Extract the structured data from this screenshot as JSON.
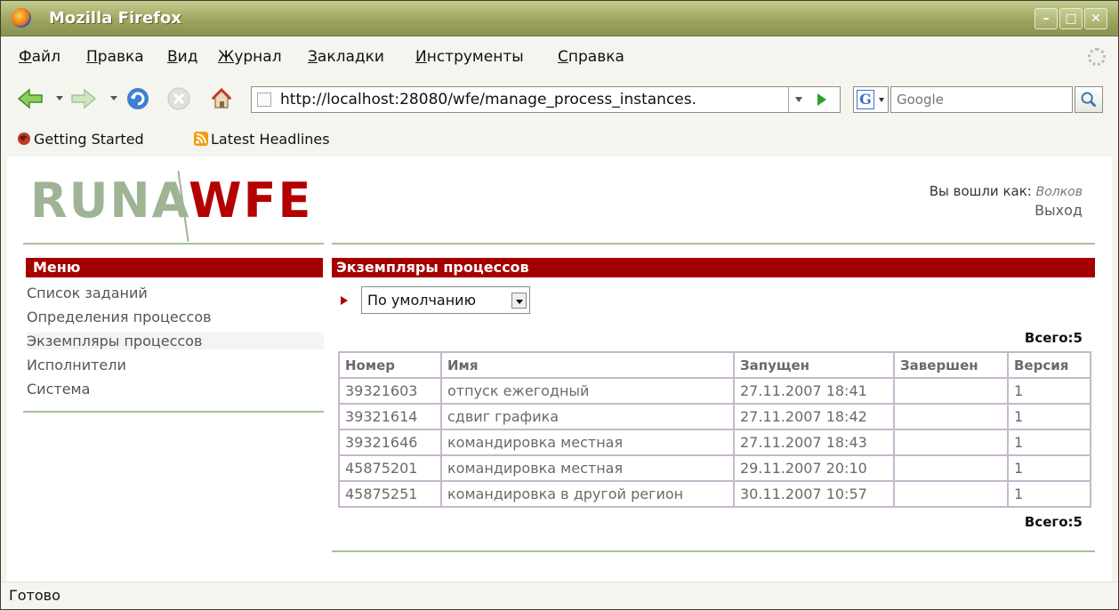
{
  "window": {
    "title": "Mozilla Firefox"
  },
  "menubar": {
    "items": [
      {
        "label": "Файл",
        "hot": "Ф",
        "rest": "айл"
      },
      {
        "label": "Правка",
        "hot": "П",
        "rest": "равка"
      },
      {
        "label": "Вид",
        "hot": "В",
        "rest": "ид"
      },
      {
        "label": "Журнал",
        "hot": "Ж",
        "rest": "урнал"
      },
      {
        "label": "Закладки",
        "hot": "З",
        "rest": "акладки"
      },
      {
        "label": "Инструменты",
        "hot": "И",
        "rest": "нструменты"
      },
      {
        "label": "Справка",
        "hot": "С",
        "rest": "правка"
      }
    ]
  },
  "navbar": {
    "url": "http://localhost:28080/wfe/manage_process_instances.",
    "search_placeholder": "Google"
  },
  "bookmarks": {
    "items": [
      "Getting Started",
      "Latest Headlines"
    ]
  },
  "page": {
    "logo_part1": "RUNA",
    "logo_part2": "WFE",
    "login_label": "Вы вошли как:",
    "login_user": "Волков",
    "logout": "Выход",
    "menu_title": "Меню",
    "menu_items": [
      "Список заданий",
      "Определения процессов",
      "Экземпляры процессов",
      "Исполнители",
      "Система"
    ],
    "section_title": "Экземпляры процессов",
    "filter_value": "По умолчанию",
    "total_top": "Всего:5",
    "total_bottom": "Всего:5",
    "table": {
      "headers": [
        "Номер",
        "Имя",
        "Запущен",
        "Завершен",
        "Версия"
      ],
      "rows": [
        [
          "39321603",
          "отпуск ежегодный",
          "27.11.2007 18:41",
          "",
          "1"
        ],
        [
          "39321614",
          "сдвиг графика",
          "27.11.2007 18:42",
          "",
          "1"
        ],
        [
          "39321646",
          "командировка местная",
          "27.11.2007 18:43",
          "",
          "1"
        ],
        [
          "45875201",
          "командировка местная",
          "29.11.2007 20:10",
          "",
          "1"
        ],
        [
          "45875251",
          "командировка в другой регион",
          "30.11.2007 10:57",
          "",
          "1"
        ]
      ]
    }
  },
  "status": {
    "text": "Готово"
  }
}
